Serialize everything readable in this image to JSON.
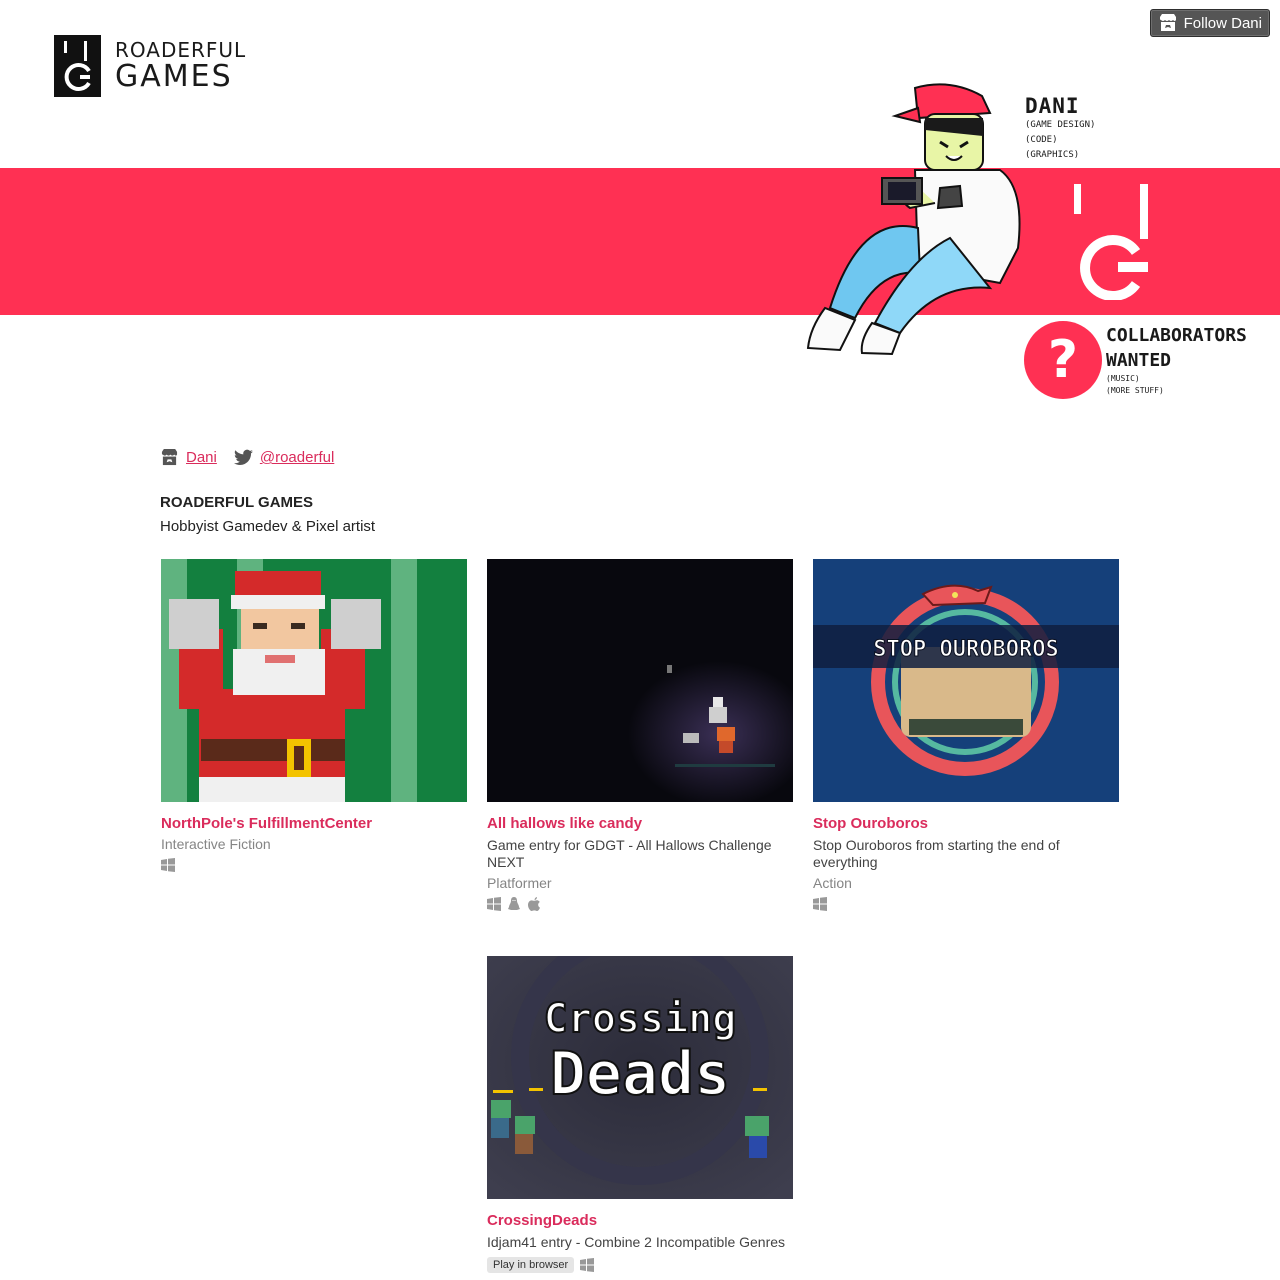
{
  "header": {
    "logo_top": "ROADERFUL",
    "logo_bottom": "GAMES",
    "follow_label": "Follow Dani",
    "banner_name": "DANI",
    "banner_roles": [
      "(GAME DESIGN)",
      "(CODE)",
      "(GRAPHICS)"
    ],
    "collab_line1": "COLLABORATORS",
    "collab_line2": "WANTED",
    "collab_roles": [
      "(MUSIC)",
      "(MORE STUFF)"
    ],
    "question_mark": "?"
  },
  "profile": {
    "user_link": "Dani",
    "twitter_link": "@roaderful",
    "title": "ROADERFUL GAMES",
    "subtitle": "Hobbyist Gamedev & Pixel artist"
  },
  "games": [
    {
      "title": "NorthPole's FulfillmentCenter",
      "description": "",
      "genre": "Interactive Fiction",
      "platforms": [
        "windows-icon"
      ]
    },
    {
      "title": "All hallows like candy",
      "description": "Game entry for GDGT - All Hallows Challenge NEXT",
      "genre": "Platformer",
      "platforms": [
        "windows-icon",
        "linux-icon",
        "apple-icon"
      ]
    },
    {
      "title": "Stop Ouroboros",
      "description": "Stop Ouroboros from starting the end of everything",
      "genre": "Action",
      "platforms": [
        "windows-icon"
      ],
      "thumb_text": "STOP OUROBOROS"
    },
    {
      "title": "CrossingDeads",
      "description": "Idjam41 entry - Combine 2 Incompatible Genres",
      "genre": "",
      "play_badge": "Play in browser",
      "platforms": [
        "windows-icon"
      ],
      "thumb_text_1": "Crossing",
      "thumb_text_2": "Deads"
    }
  ],
  "colors": {
    "accent": "#da2c5c",
    "banner_red": "#ff3053",
    "follow_bg": "#555555"
  }
}
